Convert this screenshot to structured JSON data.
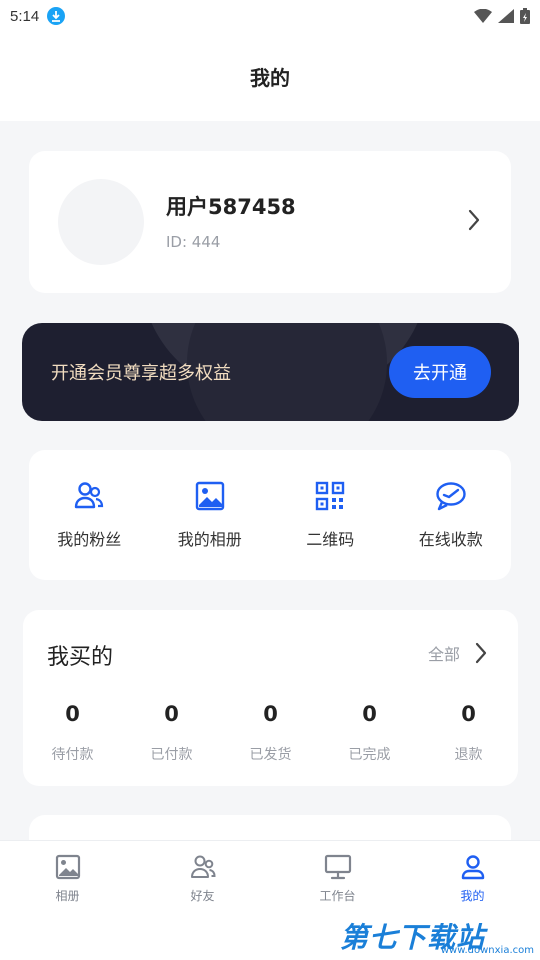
{
  "status_bar": {
    "time": "5:14"
  },
  "header": {
    "title": "我的"
  },
  "profile": {
    "username": "用户587458",
    "user_id": "ID: 444"
  },
  "vip": {
    "text": "开通会员尊享超多权益",
    "button_label": "去开通"
  },
  "quick_actions": [
    {
      "label": "我的粉丝",
      "icon": "fans-icon"
    },
    {
      "label": "我的相册",
      "icon": "album-icon"
    },
    {
      "label": "二维码",
      "icon": "qrcode-icon"
    },
    {
      "label": "在线收款",
      "icon": "payment-icon"
    }
  ],
  "orders": {
    "title": "我买的",
    "all_label": "全部",
    "stats": [
      {
        "value": "0",
        "label": "待付款"
      },
      {
        "value": "0",
        "label": "已付款"
      },
      {
        "value": "0",
        "label": "已发货"
      },
      {
        "value": "0",
        "label": "已完成"
      },
      {
        "value": "0",
        "label": "退款"
      }
    ]
  },
  "tabbar": {
    "items": [
      {
        "label": "相册",
        "icon": "album-icon",
        "active": false
      },
      {
        "label": "好友",
        "icon": "friends-icon",
        "active": false
      },
      {
        "label": "工作台",
        "icon": "monitor-icon",
        "active": false
      },
      {
        "label": "我的",
        "icon": "user-icon",
        "active": true
      }
    ]
  },
  "watermark": {
    "text": "第七下载站",
    "sub": "www.downxia.com"
  },
  "colors": {
    "accent": "#1f5ff2",
    "vip_bg": "#1e1f30",
    "vip_text": "#f1dcc0",
    "background": "#f5f6f8"
  }
}
